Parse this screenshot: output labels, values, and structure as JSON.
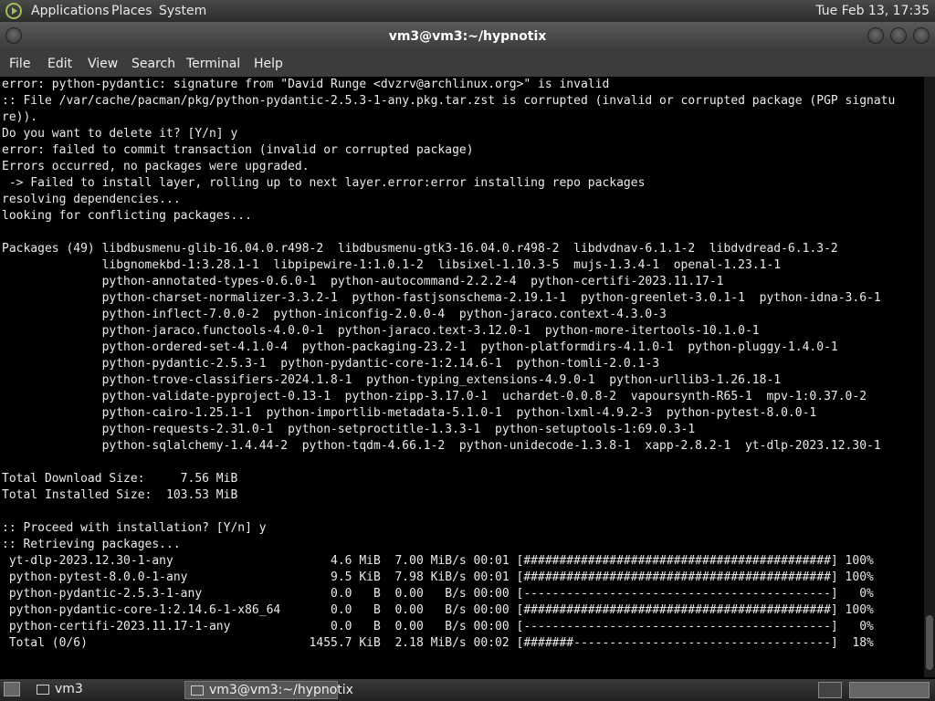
{
  "top_panel": {
    "applications": "Applications",
    "places": "Places",
    "system": "System",
    "clock": "Tue Feb 13, 17:35"
  },
  "window": {
    "title": "vm3@vm3:~/hypnotix"
  },
  "menubar": {
    "file": "File",
    "edit": "Edit",
    "view": "View",
    "search": "Search",
    "terminal": "Terminal",
    "help": "Help"
  },
  "terminal": {
    "lines": [
      "error: python-pydantic: signature from \"David Runge <dvzrv@archlinux.org>\" is invalid",
      ":: File /var/cache/pacman/pkg/python-pydantic-2.5.3-1-any.pkg.tar.zst is corrupted (invalid or corrupted package (PGP signatu",
      "re)).",
      "Do you want to delete it? [Y/n] y",
      "error: failed to commit transaction (invalid or corrupted package)",
      "Errors occurred, no packages were upgraded.",
      " -> Failed to install layer, rolling up to next layer.error:error installing repo packages",
      "resolving dependencies...",
      "looking for conflicting packages...",
      "",
      "Packages (49) libdbusmenu-glib-16.04.0.r498-2  libdbusmenu-gtk3-16.04.0.r498-2  libdvdnav-6.1.1-2  libdvdread-6.1.3-2",
      "              libgnomekbd-1:3.28.1-1  libpipewire-1:1.0.1-2  libsixel-1.10.3-5  mujs-1.3.4-1  openal-1.23.1-1",
      "              python-annotated-types-0.6.0-1  python-autocommand-2.2.2-4  python-certifi-2023.11.17-1",
      "              python-charset-normalizer-3.3.2-1  python-fastjsonschema-2.19.1-1  python-greenlet-3.0.1-1  python-idna-3.6-1",
      "              python-inflect-7.0.0-2  python-iniconfig-2.0.0-4  python-jaraco.context-4.3.0-3",
      "              python-jaraco.functools-4.0.0-1  python-jaraco.text-3.12.0-1  python-more-itertools-10.1.0-1",
      "              python-ordered-set-4.1.0-4  python-packaging-23.2-1  python-platformdirs-4.1.0-1  python-pluggy-1.4.0-1",
      "              python-pydantic-2.5.3-1  python-pydantic-core-1:2.14.6-1  python-tomli-2.0.1-3",
      "              python-trove-classifiers-2024.1.8-1  python-typing_extensions-4.9.0-1  python-urllib3-1.26.18-1",
      "              python-validate-pyproject-0.13-1  python-zipp-3.17.0-1  uchardet-0.0.8-2  vapoursynth-R65-1  mpv-1:0.37.0-2",
      "              python-cairo-1.25.1-1  python-importlib-metadata-5.1.0-1  python-lxml-4.9.2-3  python-pytest-8.0.0-1",
      "              python-requests-2.31.0-1  python-setproctitle-1.3.3-1  python-setuptools-1:69.0.3-1",
      "              python-sqlalchemy-1.4.44-2  python-tqdm-4.66.1-2  python-unidecode-1.3.8-1  xapp-2.8.2-1  yt-dlp-2023.12.30-1",
      "",
      "Total Download Size:     7.56 MiB",
      "Total Installed Size:  103.53 MiB",
      "",
      ":: Proceed with installation? [Y/n] y",
      ":: Retrieving packages...",
      " yt-dlp-2023.12.30-1-any                      4.6 MiB  7.00 MiB/s 00:01 [###########################################] 100%",
      " python-pytest-8.0.0-1-any                    9.5 KiB  7.98 KiB/s 00:01 [###########################################] 100%",
      " python-pydantic-2.5.3-1-any                  0.0   B  0.00   B/s 00:00 [-------------------------------------------]   0%",
      " python-pydantic-core-1:2.14.6-1-x86_64       0.0   B  0.00   B/s 00:00 [###########################################] 100%",
      " python-certifi-2023.11.17-1-any              0.0   B  0.00   B/s 00:00 [-------------------------------------------]   0%",
      " Total (0/6)                               1455.7 KiB  2.18 MiB/s 00:02 [#######------------------------------------]  18%"
    ]
  },
  "taskbar": {
    "task1": "vm3",
    "task2": "vm3@vm3:~/hypnotix"
  }
}
